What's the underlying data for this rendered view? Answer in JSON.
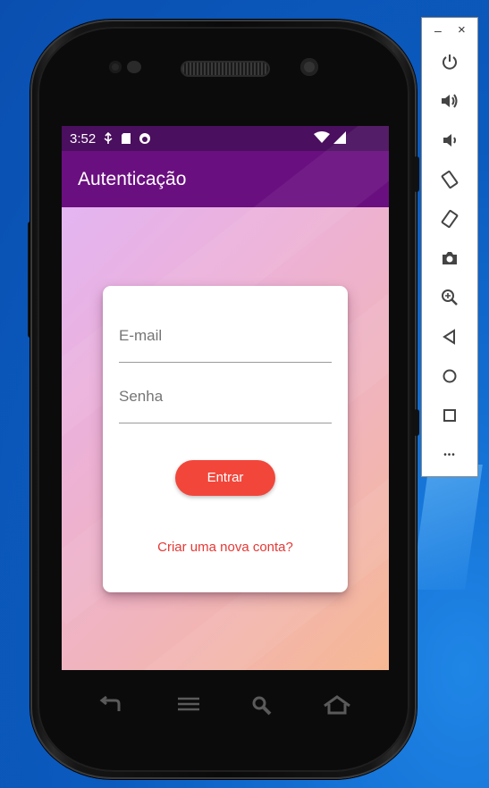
{
  "status_bar": {
    "time": "3:52"
  },
  "app_bar": {
    "title": "Autenticação"
  },
  "login": {
    "email_placeholder": "E-mail",
    "password_placeholder": "Senha",
    "submit_label": "Entrar",
    "create_account_label": "Criar uma nova conta?"
  },
  "emulator_panel": {
    "minimize": "–",
    "close": "×",
    "more": "•••"
  },
  "colors": {
    "status_bar": "#4a0f5e",
    "app_bar": "#6a0f80",
    "button": "#f2463b",
    "link": "#e53935"
  },
  "icons": [
    "power-icon",
    "volume-up-icon",
    "volume-down-icon",
    "rotate-left-icon",
    "rotate-right-icon",
    "camera-icon",
    "zoom-icon",
    "back-icon",
    "home-icon",
    "overview-icon",
    "more-icon"
  ]
}
